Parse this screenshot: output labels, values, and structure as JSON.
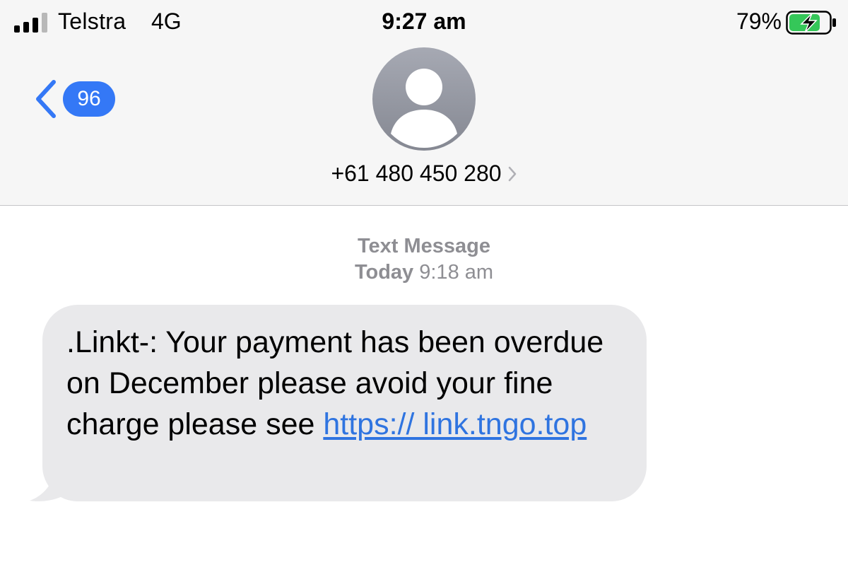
{
  "status_bar": {
    "carrier": "Telstra",
    "network": "4G",
    "time": "9:27 am",
    "battery_percent": "79%",
    "battery_level": 0.79,
    "icons": [
      "signal-icon",
      "battery-charging-icon"
    ]
  },
  "nav": {
    "back_badge_count": "96",
    "contact": "+61 480 450 280",
    "icons": [
      "chevron-left-icon",
      "person-avatar-icon",
      "chevron-right-icon"
    ]
  },
  "thread": {
    "label": "Text Message",
    "timestamp_day": "Today",
    "timestamp_time": "9:18 am"
  },
  "message": {
    "text_before_link": ".Linkt-: Your payment has been overdue on December please avoid your fine charge please see ",
    "link": "https:// link.tngo.top"
  },
  "colors": {
    "accent": "#3478f6",
    "bubble_incoming": "#e9e9eb",
    "header_bg": "#f6f6f6",
    "meta_text": "#8e8e93",
    "battery_charge": "#35c759"
  }
}
